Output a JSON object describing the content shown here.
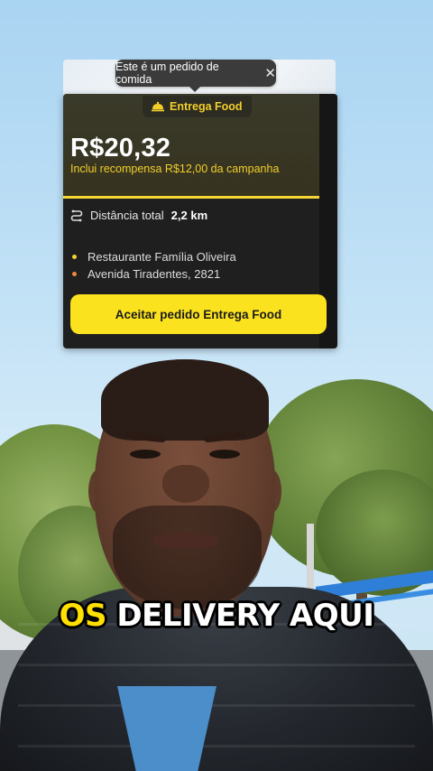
{
  "tooltip": {
    "text": "Este é um pedido de comida",
    "close_icon": "close-icon"
  },
  "offer": {
    "badge_label": "Entrega Food",
    "badge_icon": "cloche-icon",
    "price": "R$20,32",
    "reward_note": "Inclui recompensa R$12,00 da campanha",
    "distance_icon": "route-icon",
    "distance_label": "Distância total",
    "distance_value": "2,2 km",
    "stops": [
      {
        "label": "Restaurante Família Oliveira",
        "dot_color": "#f2d233"
      },
      {
        "label": "Avenida Tiradentes, 2821",
        "dot_color": "#f0873a"
      }
    ],
    "accept_button_label": "Aceitar pedido Entrega Food"
  },
  "caption": {
    "highlight": "OS",
    "rest": "DELIVERY AQUI"
  },
  "colors": {
    "accent_yellow": "#fbe21f",
    "card_dark": "#1f1f1f",
    "reward_text": "#f2cf2a"
  }
}
